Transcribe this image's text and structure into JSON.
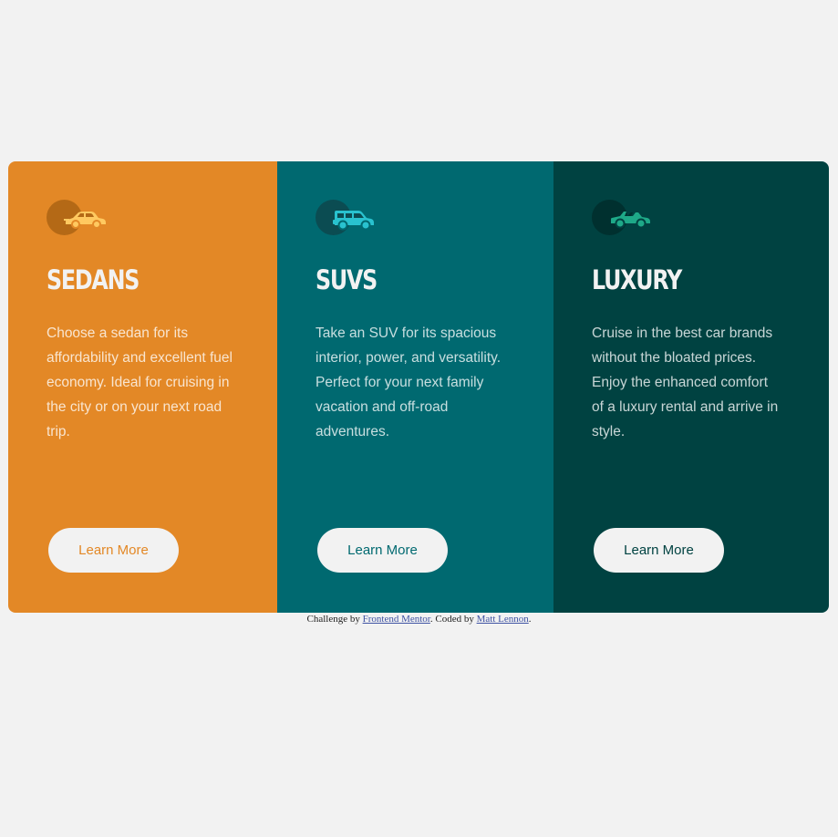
{
  "cards": [
    {
      "icon": "sedan-car-icon",
      "title": "SEDANS",
      "text": "Choose a sedan for its affordability and excellent fuel economy. Ideal for cruising in the city or on your next road trip.",
      "button_label": "Learn More",
      "color": "#e38826"
    },
    {
      "icon": "suv-car-icon",
      "title": "SUVS",
      "text": "Take an SUV for its spacious interior, power, and versatility. Perfect for your next family vacation and off-road adventures.",
      "button_label": "Learn More",
      "color": "#006970"
    },
    {
      "icon": "luxury-car-icon",
      "title": "LUXURY",
      "text": "Cruise in the best car brands without the bloated prices. Enjoy the enhanced comfort of a luxury rental and arrive in style.",
      "button_label": "Learn More",
      "color": "#004241"
    }
  ],
  "attribution": {
    "prefix": "Challenge by ",
    "link1": "Frontend Mentor",
    "middle": ". Coded by ",
    "link2": "Matt Lennon",
    "suffix": "."
  },
  "colors": {
    "background": "#f2f2f2",
    "icon_sedan": "#ffc960",
    "icon_suv": "#29c2cf",
    "icon_luxury": "#1ea988"
  }
}
